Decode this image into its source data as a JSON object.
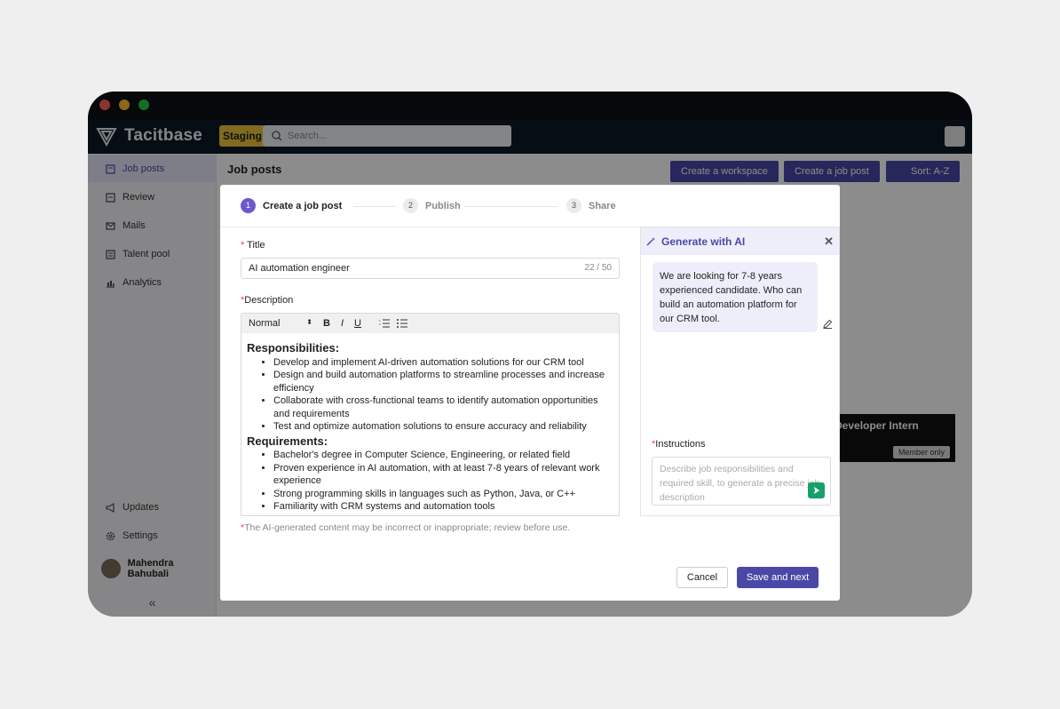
{
  "app": {
    "name": "Tacitbase",
    "env_badge": "Staging",
    "search_placeholder": "Search..."
  },
  "sidebar": {
    "items": [
      {
        "label": "Job posts",
        "icon": "job-posts-icon"
      },
      {
        "label": "Review",
        "icon": "review-icon"
      },
      {
        "label": "Mails",
        "icon": "mail-icon"
      },
      {
        "label": "Talent pool",
        "icon": "talent-pool-icon"
      },
      {
        "label": "Analytics",
        "icon": "analytics-icon"
      }
    ],
    "bottom": [
      {
        "label": "Updates",
        "icon": "megaphone-icon"
      },
      {
        "label": "Settings",
        "icon": "gear-icon"
      }
    ],
    "user_name": "Mahendra Bahubali",
    "collapse_glyph": "«"
  },
  "header": {
    "title": "Job posts",
    "buttons": [
      "Create a workspace",
      "Create a job post",
      "Sort: A-Z"
    ]
  },
  "background_card": {
    "title": "Developer Intern",
    "badge": "Member only"
  },
  "modal": {
    "steps": [
      {
        "num": "1",
        "label": "Create a job post"
      },
      {
        "num": "2",
        "label": "Publish"
      },
      {
        "num": "3",
        "label": "Share"
      }
    ],
    "title_label": "Title",
    "title_value": "AI automation engineer",
    "title_count": "22 / 50",
    "description_label": "Description",
    "toolbar": {
      "format": "Normal",
      "bold": "B",
      "italic": "I",
      "underline": "U"
    },
    "editor": {
      "h1": "Responsibilities:",
      "resp": [
        "Develop and implement AI-driven automation solutions for our CRM tool",
        "Design and build automation platforms to streamline processes and increase efficiency",
        "Collaborate with cross-functional teams to identify automation opportunities and requirements",
        "Test and optimize automation solutions to ensure accuracy and reliability"
      ],
      "h2": "Requirements:",
      "reqs": [
        "Bachelor's degree in Computer Science, Engineering, or related field",
        "Proven experience in AI automation, with at least 7-8 years of relevant work experience",
        "Strong programming skills in languages such as Python, Java, or C++",
        "Familiarity with CRM systems and automation tools"
      ]
    },
    "disclaimer": "The AI-generated content may be incorrect or inappropriate; review before use.",
    "ai": {
      "title": "Generate with AI",
      "message": "We are looking for 7-8 years experienced candidate. Who can build an automation platform for our CRM tool.",
      "instructions_label": "Instructions",
      "instructions_placeholder": "Describe job responsibilities and required skill, to generate a precise job description"
    },
    "cancel_label": "Cancel",
    "save_label": "Save and next"
  },
  "colors": {
    "accent": "#4a48a6",
    "staging": "#e9c43a",
    "send": "#16a06a"
  }
}
